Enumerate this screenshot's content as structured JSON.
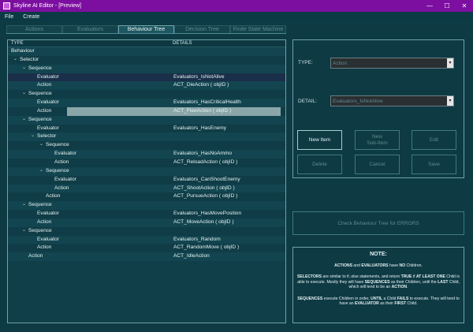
{
  "window": {
    "title": "Skyline AI Editor - [Preview]",
    "minimize": "—",
    "maximize": "☐",
    "close": "✕"
  },
  "menu": {
    "file": "File",
    "create": "Create"
  },
  "tabs": [
    "Actions",
    "Evaluators",
    "Behaviour Tree",
    "Decision Tree",
    "Finite State Machine"
  ],
  "tree": {
    "headers": {
      "type": "TYPE",
      "details": "DETAILS"
    },
    "rows": [
      {
        "type": "Behaviour",
        "details": "",
        "indent": 0,
        "chev": false
      },
      {
        "type": "Selector",
        "details": "",
        "indent": 1,
        "chev": true
      },
      {
        "type": "Sequence",
        "details": "",
        "indent": 2,
        "chev": true
      },
      {
        "type": "Evaluator",
        "details": "Evaluators_IsNotAlive",
        "indent": 3,
        "chev": false
      },
      {
        "type": "Action",
        "details": "ACT_DieAction ( objID )",
        "indent": 3,
        "chev": false
      },
      {
        "type": "Sequence",
        "details": "",
        "indent": 2,
        "chev": true
      },
      {
        "type": "Evaluator",
        "details": "Evaluators_HasCriticalHealth",
        "indent": 3,
        "chev": false
      },
      {
        "type": "Action",
        "details": "ACT_FleeAction ( objID )",
        "indent": 3,
        "chev": false
      },
      {
        "type": "Sequence",
        "details": "",
        "indent": 2,
        "chev": true
      },
      {
        "type": "Evaluator",
        "details": "Evaluators_HasEnemy",
        "indent": 3,
        "chev": false
      },
      {
        "type": "Selector",
        "details": "",
        "indent": 3,
        "chev": true
      },
      {
        "type": "Sequence",
        "details": "",
        "indent": 4,
        "chev": true
      },
      {
        "type": "Evaluator",
        "details": "Evaluators_HasNoAmmo",
        "indent": 5,
        "chev": false
      },
      {
        "type": "Action",
        "details": "ACT_ReloadAction ( objID )",
        "indent": 5,
        "chev": false
      },
      {
        "type": "Sequence",
        "details": "",
        "indent": 4,
        "chev": true
      },
      {
        "type": "Evaluator",
        "details": "Evaluators_CanShootEnemy",
        "indent": 5,
        "chev": false
      },
      {
        "type": "Action",
        "details": "ACT_ShootAction ( objID )",
        "indent": 5,
        "chev": false
      },
      {
        "type": "Action",
        "details": "ACT_PursueAction ( objID )",
        "indent": 4,
        "chev": false
      },
      {
        "type": "Sequence",
        "details": "",
        "indent": 2,
        "chev": true
      },
      {
        "type": "Evaluator",
        "details": "Evaluators_HasMovePosition",
        "indent": 3,
        "chev": false
      },
      {
        "type": "Action",
        "details": "ACT_MoveAction ( objID )",
        "indent": 3,
        "chev": false
      },
      {
        "type": "Sequence",
        "details": "",
        "indent": 2,
        "chev": true
      },
      {
        "type": "Evaluator",
        "details": "Evaluators_Random",
        "indent": 3,
        "chev": false
      },
      {
        "type": "Action",
        "details": "ACT_RandomMove ( objID )",
        "indent": 3,
        "chev": false
      },
      {
        "type": "Action",
        "details": "ACT_IdleAction",
        "indent": 2,
        "chev": false
      }
    ]
  },
  "editor": {
    "type_label": "TYPE:",
    "type_value": "Action",
    "detail_label": "DETAIL:",
    "detail_value": "Evaluators_IsNotAlive",
    "new_item": "New Item",
    "new_sub_item_1": "New",
    "new_sub_item_2": "Sub-Item",
    "edit": "Edit",
    "delete": "Delete",
    "cancel": "Cancel",
    "save": "Save"
  },
  "check_button": "Check Behaviour Tree for ERRORS",
  "note": {
    "title": "NOTE:",
    "p1": [
      {
        "t": "ACTIONS",
        "b": true
      },
      {
        "t": " and ",
        "b": false
      },
      {
        "t": "EVALUATORS",
        "b": true
      },
      {
        "t": " have ",
        "b": false
      },
      {
        "t": "NO",
        "b": true
      },
      {
        "t": " Children.",
        "b": false
      }
    ],
    "p2": [
      {
        "t": "SELECTORS",
        "b": true
      },
      {
        "t": " are similar to if..else statements, and return ",
        "b": false
      },
      {
        "t": "TRUE",
        "b": true
      },
      {
        "t": " if ",
        "b": false
      },
      {
        "t": "AT LEAST ONE",
        "b": true
      },
      {
        "t": " Child is able to execute. Mostly they will have ",
        "b": false
      },
      {
        "t": "SEQUENCES",
        "b": true
      },
      {
        "t": " as their Children, until the ",
        "b": false
      },
      {
        "t": "LAST",
        "b": true
      },
      {
        "t": " Child, which will tend to be an ",
        "b": false
      },
      {
        "t": "ACTION",
        "b": true
      },
      {
        "t": ".",
        "b": false
      }
    ],
    "p3": [
      {
        "t": "SEQUENCES",
        "b": true
      },
      {
        "t": " execute Children in order, ",
        "b": false
      },
      {
        "t": "UNTIL",
        "b": true
      },
      {
        "t": " a Child ",
        "b": false
      },
      {
        "t": "FAILS",
        "b": true
      },
      {
        "t": " to execute. They will tend to have an ",
        "b": false
      },
      {
        "t": "EVALUATOR",
        "b": true
      },
      {
        "t": " as their ",
        "b": false
      },
      {
        "t": "FIRST",
        "b": true
      },
      {
        "t": " Child.",
        "b": false
      }
    ]
  },
  "colors": {
    "titlebar": "#7d0fa0",
    "background": "#0e3a44",
    "accent_border": "#6fa3aa"
  }
}
